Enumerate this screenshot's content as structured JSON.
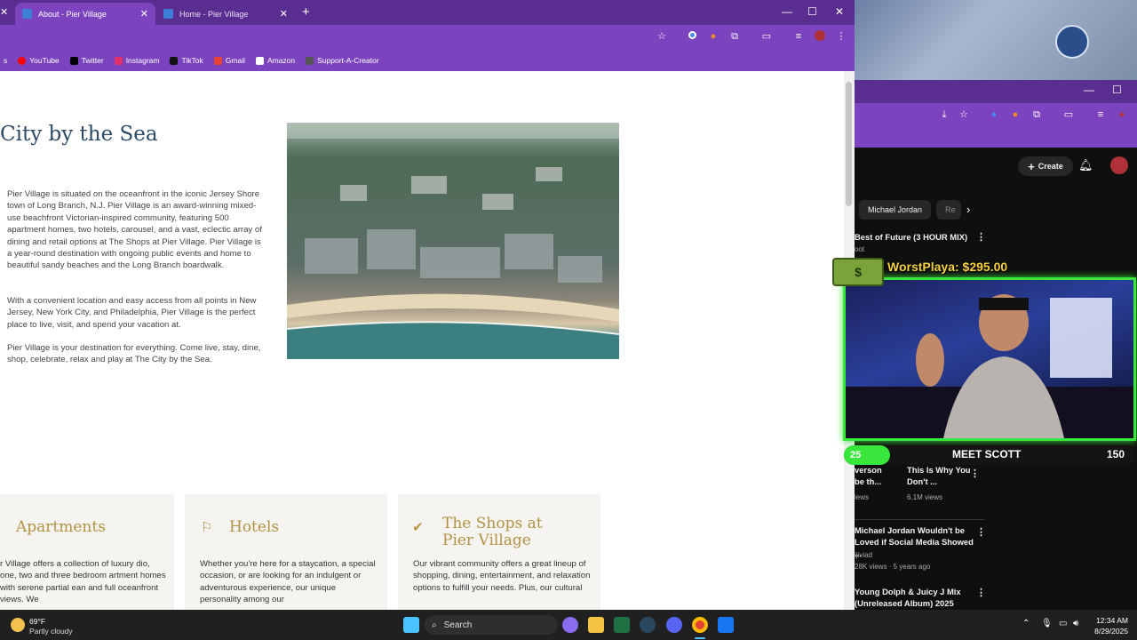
{
  "browser_left": {
    "tabs": [
      {
        "label": "About - Pier Village",
        "active": true
      },
      {
        "label": "Home - Pier Village",
        "active": false
      }
    ],
    "bookmarks": [
      {
        "label": "YouTube",
        "color": "#ff0000"
      },
      {
        "label": "Twitter",
        "color": "#000000"
      },
      {
        "label": "Instagram",
        "color": "#e1306c"
      },
      {
        "label": "TikTok",
        "color": "#111111"
      },
      {
        "label": "Gmail",
        "color": "#ea4335"
      },
      {
        "label": "Amazon",
        "color": "#222222"
      },
      {
        "label": "Support-A-Creator",
        "color": "#444444"
      }
    ]
  },
  "page": {
    "hero_title": "City by the Sea",
    "paragraphs": [
      "Pier Village is situated on the oceanfront in the iconic Jersey Shore town of Long Branch, N.J. Pier Village is an award-winning mixed-use beachfront Victorian-inspired community, featuring 500 apartment homes, two hotels, carousel, and a vast, eclectic array of dining and retail options at The Shops at Pier Village. Pier Village is a year-round destination with ongoing public events and home to beautiful sandy beaches and the Long Branch boardwalk.",
      "With a convenient location and easy access from all points in New Jersey, New York City, and Philadelphia, Pier Village is the perfect place to live, visit, and spend your vacation at.",
      "Pier Village is your destination for everything. Come live, stay, dine, shop, celebrate, relax and play at The City by the Sea."
    ],
    "cards": [
      {
        "title": "Apartments",
        "text": "r Village offers a collection of luxury dio, one, two and three bedroom artment homes with serene partial ean and full oceanfront views. We"
      },
      {
        "title": "Hotels",
        "text": "Whether you're here for a staycation, a special occasion, or are looking for an indulgent or adventurous experience, our unique personality among our"
      },
      {
        "title": "The Shops at Pier Village",
        "text": "Our vibrant community offers a great lineup of shopping, dining, entertainment, and relaxation options to fulfill your needs. Plus, our cultural"
      }
    ]
  },
  "youtube": {
    "create_label": "Create",
    "chips": [
      "Michael Jordan",
      "Re"
    ],
    "videos": [
      {
        "title": "Best of Future (3 HOUR MIX)",
        "meta": "oot"
      },
      {
        "title": "verson be th...",
        "meta": "iews"
      },
      {
        "title": "This Is Why You Don't ...",
        "meta": "6.1M views"
      },
      {
        "title": "Michael Jordan Wouldn't be Loved if Social Media Showed ...",
        "channel": "ijiviad",
        "meta": "28K views · 5 years ago"
      },
      {
        "title": "Young Dolph & Juicy J Mix (Unreleased Album) 2025",
        "meta": ""
      }
    ]
  },
  "stream": {
    "donation": "WorstPlaya: $295.00",
    "left_count": "25",
    "name": "MEET SCOTT",
    "right_count": "150"
  },
  "taskbar": {
    "temperature": "69°F",
    "condition": "Partly cloudy",
    "search_label": "Search",
    "time": "12:34 AM",
    "date": "8/29/2025"
  }
}
